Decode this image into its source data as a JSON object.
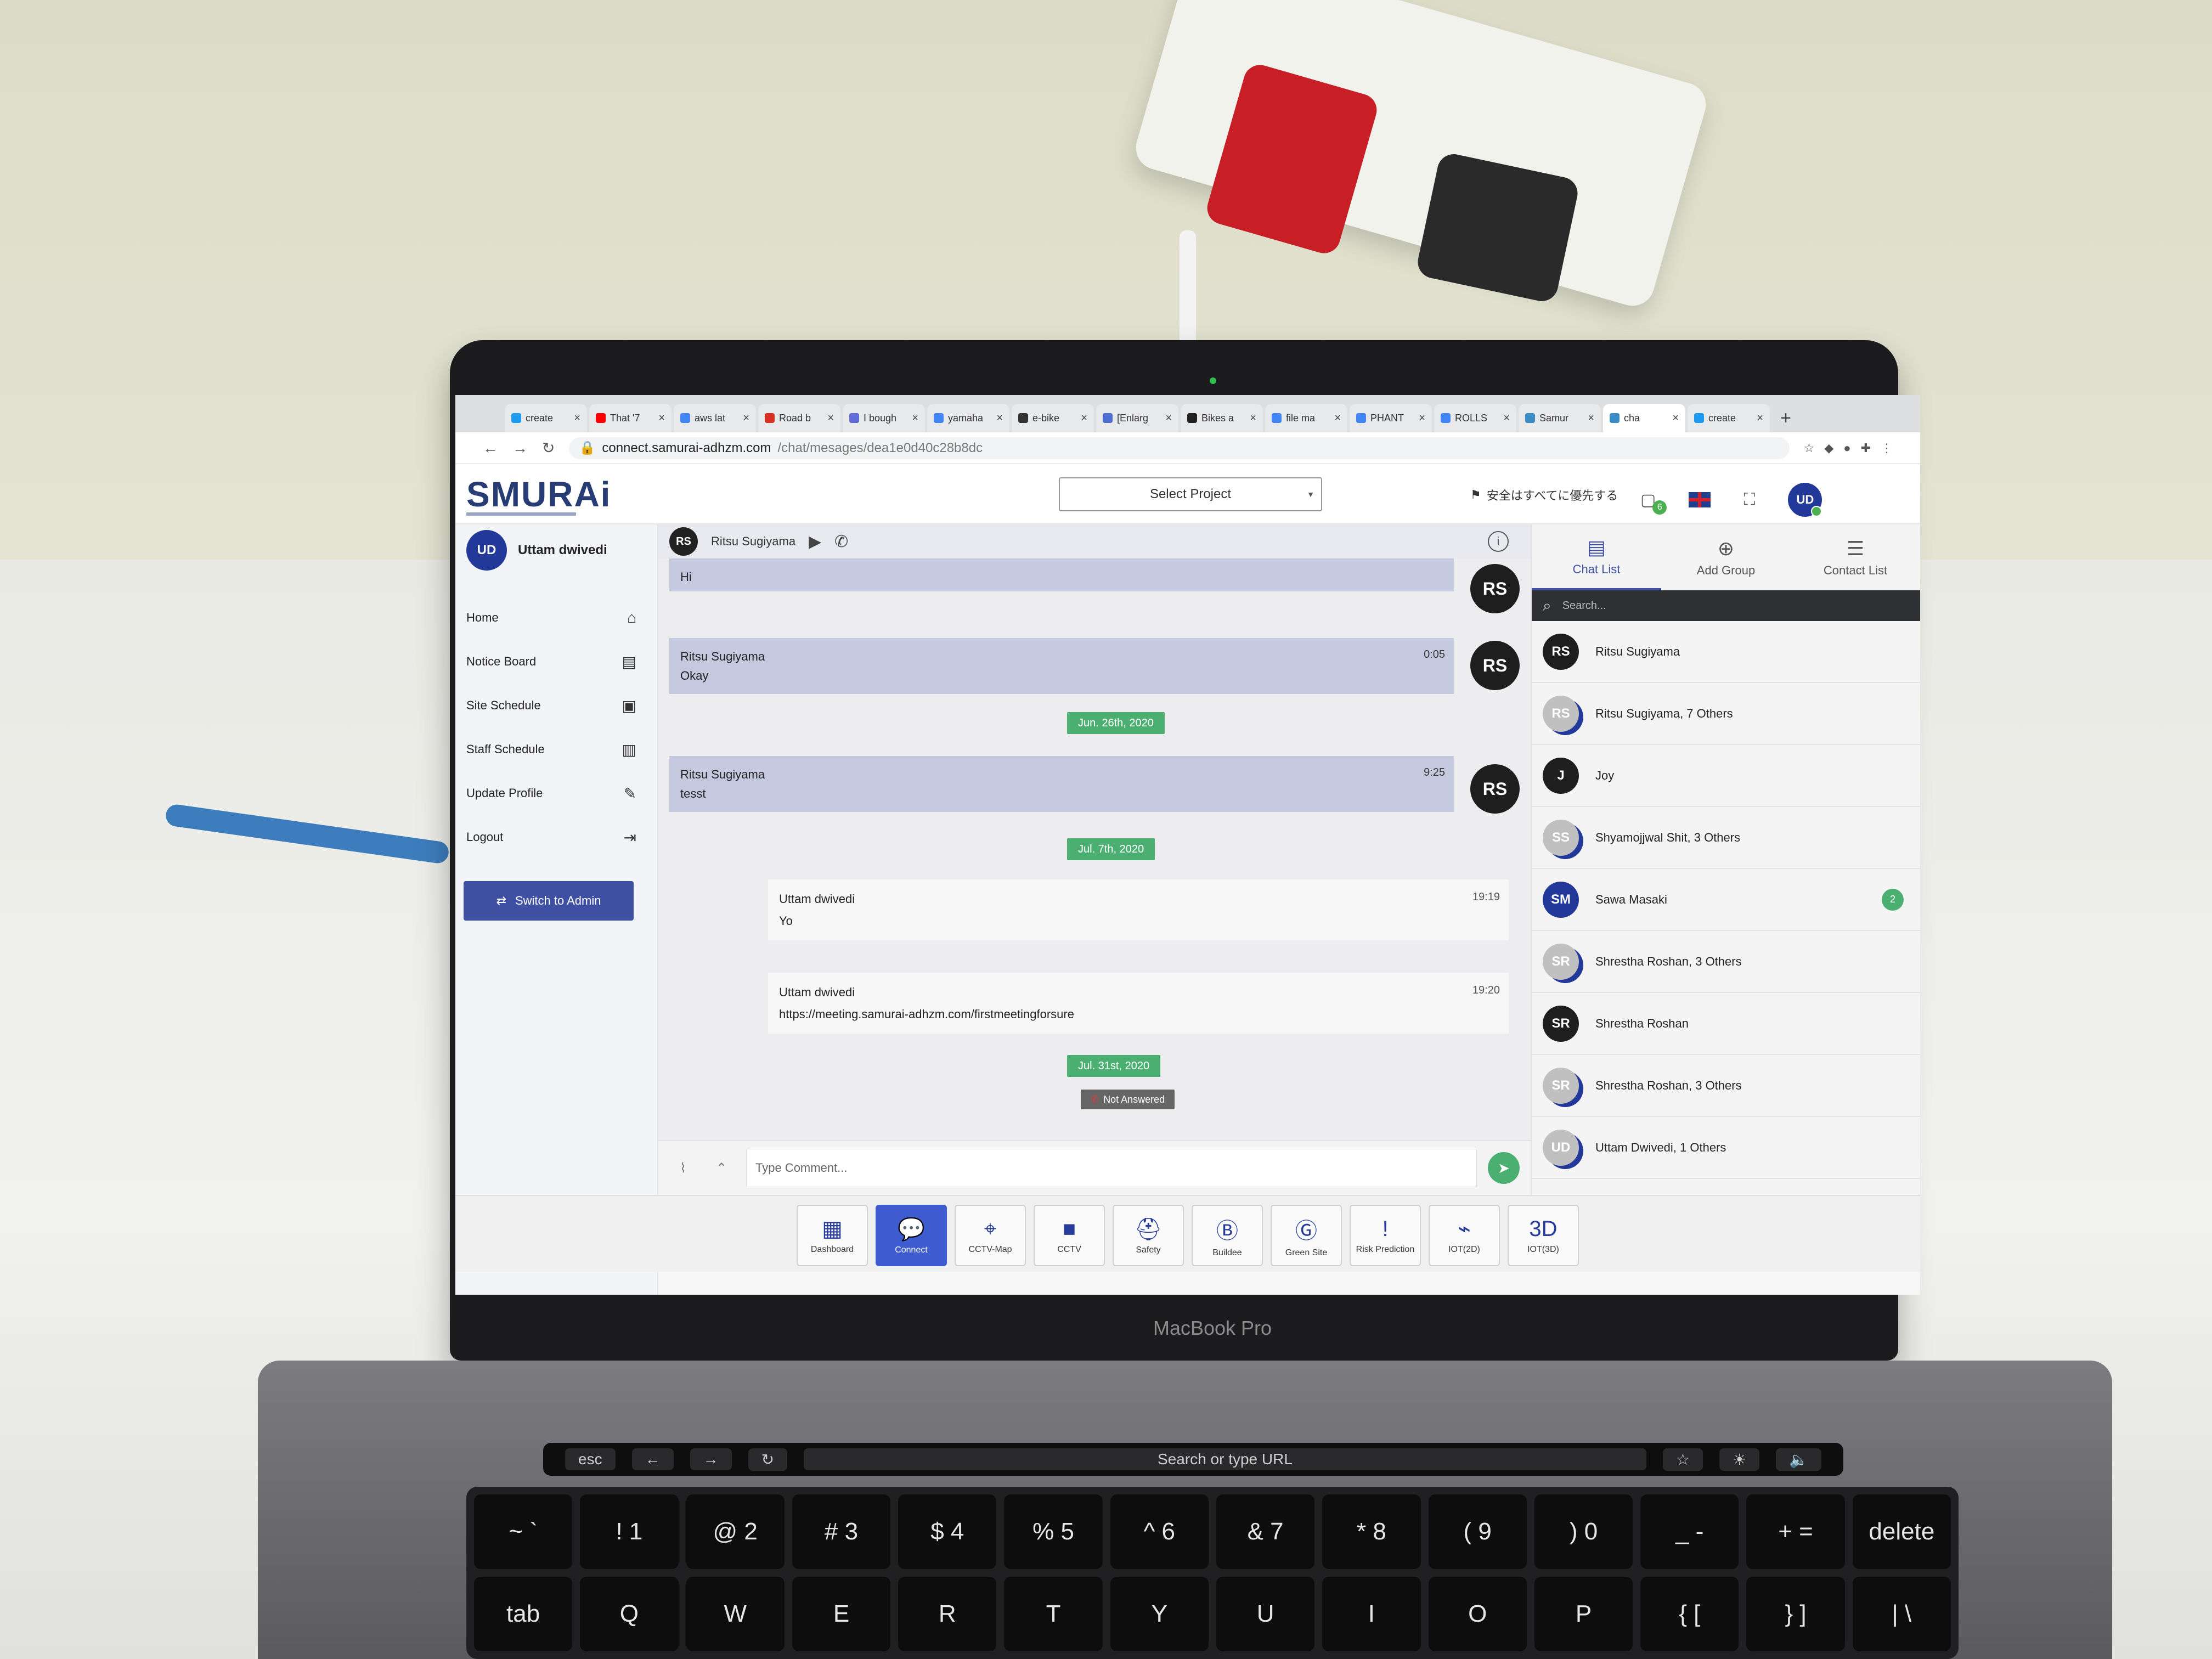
{
  "browser": {
    "tabs": [
      {
        "label": "create",
        "color": "#1d9bf0",
        "active": false
      },
      {
        "label": "That '7",
        "color": "#ff0000",
        "active": false
      },
      {
        "label": "aws lat",
        "color": "#4285f4",
        "active": false
      },
      {
        "label": "Road b",
        "color": "#d93025",
        "active": false
      },
      {
        "label": "I bough",
        "color": "#5f6bd6",
        "active": false
      },
      {
        "label": "yamaha",
        "color": "#4285f4",
        "active": false
      },
      {
        "label": "e-bike",
        "color": "#333333",
        "active": false
      },
      {
        "label": "[Enlarg",
        "color": "#4a6fd1",
        "active": false
      },
      {
        "label": "Bikes a",
        "color": "#222222",
        "active": false
      },
      {
        "label": "file ma",
        "color": "#4285f4",
        "active": false
      },
      {
        "label": "PHANT",
        "color": "#4285f4",
        "active": false
      },
      {
        "label": "ROLLS",
        "color": "#4285f4",
        "active": false
      },
      {
        "label": "Samur",
        "color": "#3b8cc4",
        "active": false
      },
      {
        "label": "cha",
        "color": "#3b8cc4",
        "active": true
      },
      {
        "label": "create",
        "color": "#1d9bf0",
        "active": false
      }
    ],
    "url_host": "connect.samurai-adhzm.com",
    "url_path": "/chat/mesages/dea1e0d40c28b8dc"
  },
  "header": {
    "logo": "SMURAi",
    "select_project": "Select Project",
    "safety_banner": "安全はすべてに優先する",
    "notification_count": "6",
    "user_initials": "UD"
  },
  "sidebar": {
    "user_initials": "UD",
    "user_name": "Uttam dwivedi",
    "items": [
      {
        "label": "Home",
        "icon": "⌂"
      },
      {
        "label": "Notice Board",
        "icon": "▤"
      },
      {
        "label": "Site Schedule",
        "icon": "▣"
      },
      {
        "label": "Staff Schedule",
        "icon": "▥"
      },
      {
        "label": "Update Profile",
        "icon": "✎"
      },
      {
        "label": "Logout",
        "icon": "⇥"
      }
    ],
    "switch_admin": "Switch to Admin"
  },
  "chat": {
    "header_initials": "RS",
    "header_name": "Ritsu Sugiyama",
    "messages": {
      "m1_text": "Hi",
      "m2_sender": "Ritsu Sugiyama",
      "m2_text": "Okay",
      "m2_time": "0:05",
      "date1": "Jun. 26th, 2020",
      "m3_sender": "Ritsu Sugiyama",
      "m3_text": "tesst",
      "m3_time": "9:25",
      "date2": "Jul. 7th, 2020",
      "m4_sender": "Uttam dwivedi",
      "m4_text": "Yo",
      "m4_time": "19:19",
      "m5_sender": "Uttam dwivedi",
      "m5_text": "https://meeting.samurai-adhzm.com/firstmeetingforsure",
      "m5_time": "19:20",
      "date3": "Jul. 31st, 2020",
      "not_answered": "Not Answered",
      "avatar": "RS"
    },
    "composer_placeholder": "Type Comment..."
  },
  "right_panel": {
    "tabs": [
      {
        "label": "Chat List",
        "icon": "▤"
      },
      {
        "label": "Add Group",
        "icon": "⊕"
      },
      {
        "label": "Contact List",
        "icon": "☰"
      }
    ],
    "search_placeholder": "Search...",
    "contacts": [
      {
        "initials": "RS",
        "name": "Ritsu Sugiyama",
        "style": "dark",
        "unread": ""
      },
      {
        "initials": "RS",
        "name": "Ritsu Sugiyama, 7 Others",
        "style": "group",
        "unread": ""
      },
      {
        "initials": "J",
        "name": "Joy",
        "style": "dark",
        "unread": ""
      },
      {
        "initials": "SS",
        "name": "Shyamojjwal Shit, 3 Others",
        "style": "group",
        "unread": ""
      },
      {
        "initials": "SM",
        "name": "Sawa Masaki",
        "style": "navy",
        "unread": "2"
      },
      {
        "initials": "SR",
        "name": "Shrestha Roshan, 3 Others",
        "style": "group",
        "unread": ""
      },
      {
        "initials": "SR",
        "name": "Shrestha Roshan",
        "style": "dark",
        "unread": ""
      },
      {
        "initials": "SR",
        "name": "Shrestha Roshan, 3 Others",
        "style": "group",
        "unread": ""
      },
      {
        "initials": "UD",
        "name": "Uttam Dwivedi, 1 Others",
        "style": "group",
        "unread": ""
      }
    ]
  },
  "bottom_bar": {
    "apps": [
      {
        "label": "Dashboard",
        "icon": "▦",
        "active": false
      },
      {
        "label": "Connect",
        "icon": "💬",
        "active": true
      },
      {
        "label": "CCTV-Map",
        "icon": "⌖",
        "active": false
      },
      {
        "label": "CCTV",
        "icon": "■",
        "active": false
      },
      {
        "label": "Safety",
        "icon": "⛑",
        "active": false
      },
      {
        "label": "Buildee",
        "icon": "Ⓑ",
        "active": false
      },
      {
        "label": "Green Site",
        "icon": "Ⓖ",
        "active": false
      },
      {
        "label": "Risk Prediction",
        "icon": "!",
        "active": false
      },
      {
        "label": "IOT(2D)",
        "icon": "⌁",
        "active": false
      },
      {
        "label": "IOT(3D)",
        "icon": "3D",
        "active": false
      }
    ]
  },
  "device": {
    "model_label": "MacBook Pro",
    "touchbar_search": "Search or type URL",
    "keys_row1": [
      "~ `",
      "! 1",
      "@ 2",
      "# 3",
      "$ 4",
      "% 5",
      "^ 6",
      "& 7",
      "* 8",
      "( 9",
      ") 0",
      "_ -",
      "+ =",
      "delete"
    ],
    "keys_row2": [
      "tab",
      "Q",
      "W",
      "E",
      "R",
      "T",
      "Y",
      "U",
      "I",
      "O",
      "P",
      "{ [",
      "} ]",
      "| \\"
    ]
  }
}
